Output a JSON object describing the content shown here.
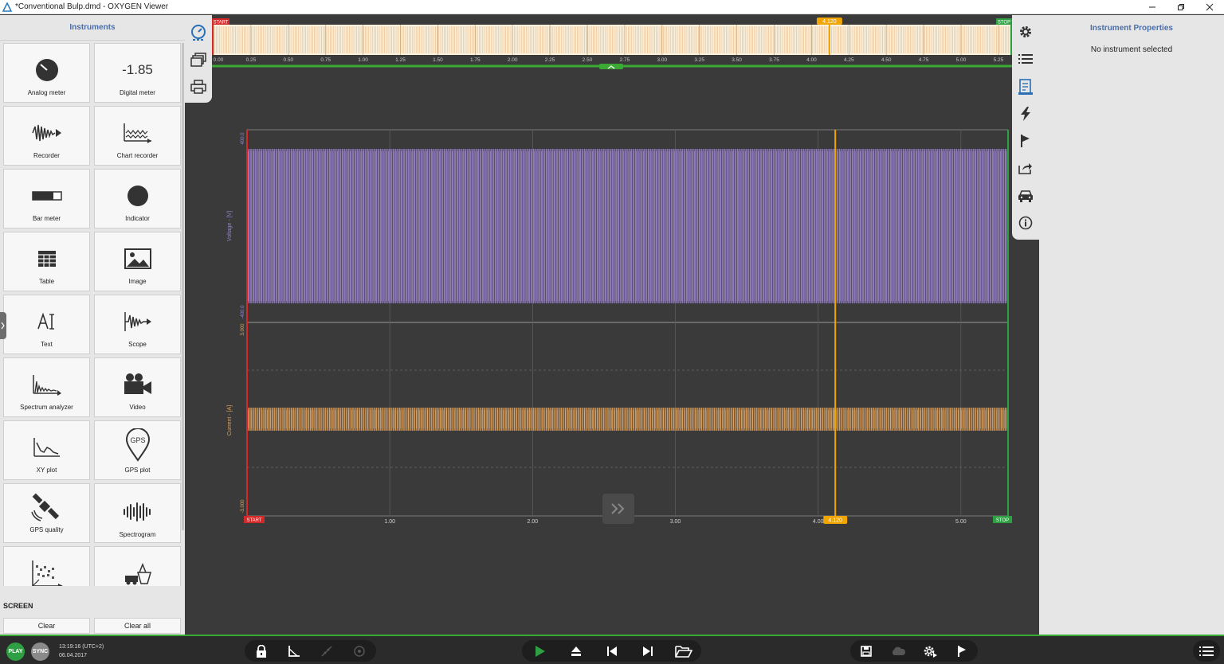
{
  "window": {
    "title": "*Conventional Bulp.dmd - OXYGEN Viewer"
  },
  "left_panel": {
    "header": "Instruments",
    "instruments": [
      {
        "label": "Analog meter",
        "icon": "analog-meter-icon"
      },
      {
        "label": "Digital meter",
        "icon": "digital-meter-icon",
        "display_value": "-1.85"
      },
      {
        "label": "Recorder",
        "icon": "recorder-icon"
      },
      {
        "label": "Chart recorder",
        "icon": "chart-recorder-icon"
      },
      {
        "label": "Bar meter",
        "icon": "bar-meter-icon"
      },
      {
        "label": "Indicator",
        "icon": "indicator-icon"
      },
      {
        "label": "Table",
        "icon": "table-icon"
      },
      {
        "label": "Image",
        "icon": "image-icon"
      },
      {
        "label": "Text",
        "icon": "text-icon"
      },
      {
        "label": "Scope",
        "icon": "scope-icon"
      },
      {
        "label": "Spectrum analyzer",
        "icon": "spectrum-analyzer-icon"
      },
      {
        "label": "Video",
        "icon": "video-icon"
      },
      {
        "label": "XY plot",
        "icon": "xy-plot-icon"
      },
      {
        "label": "GPS plot",
        "icon": "gps-plot-icon"
      },
      {
        "label": "GPS quality",
        "icon": "gps-quality-icon"
      },
      {
        "label": "Spectrogram",
        "icon": "spectrogram-icon"
      }
    ],
    "screen_label": "SCREEN",
    "clear_label": "Clear",
    "clear_all_label": "Clear all"
  },
  "right_panel": {
    "header": "Instrument Properties",
    "empty_text": "No instrument selected"
  },
  "overview": {
    "start_label": "START",
    "stop_label": "STOP",
    "cursor_label": "4.120",
    "ticks": [
      "0.00",
      "0.25",
      "0.50",
      "0.75",
      "1.00",
      "1.25",
      "1.50",
      "1.75",
      "2.00",
      "2.25",
      "2.50",
      "2.75",
      "3.00",
      "3.25",
      "3.50",
      "3.75",
      "4.00",
      "4.25",
      "4.50",
      "4.75",
      "5.00",
      "5.25"
    ]
  },
  "plot": {
    "voltage_axis_label": "Voltage - [V]",
    "current_axis_label": "Current - [A]",
    "voltage_top": "400.0",
    "voltage_bottom": "-400.0",
    "current_top": "3.000",
    "current_bottom": "-3.000",
    "x_ticks": [
      "1.00",
      "2.00",
      "3.00",
      "4.00",
      "5.00"
    ],
    "start_label": "START",
    "stop_label": "STOP",
    "cursor_label": "4.120",
    "cursor_x": 4.12,
    "x_range": [
      0,
      5.33
    ],
    "voltage_color": "#9b82d0",
    "current_color": "#e6a35a",
    "cursor_color": "#f0a500"
  },
  "status": {
    "play_label": "PLAY",
    "sync_label": "SYNC",
    "time": "13:19:16 (UTC+2)",
    "date": "06.04.2017"
  },
  "colors": {
    "accent": "#4a6ea9",
    "start_red": "#d62828",
    "stop_green": "#2ea043"
  }
}
